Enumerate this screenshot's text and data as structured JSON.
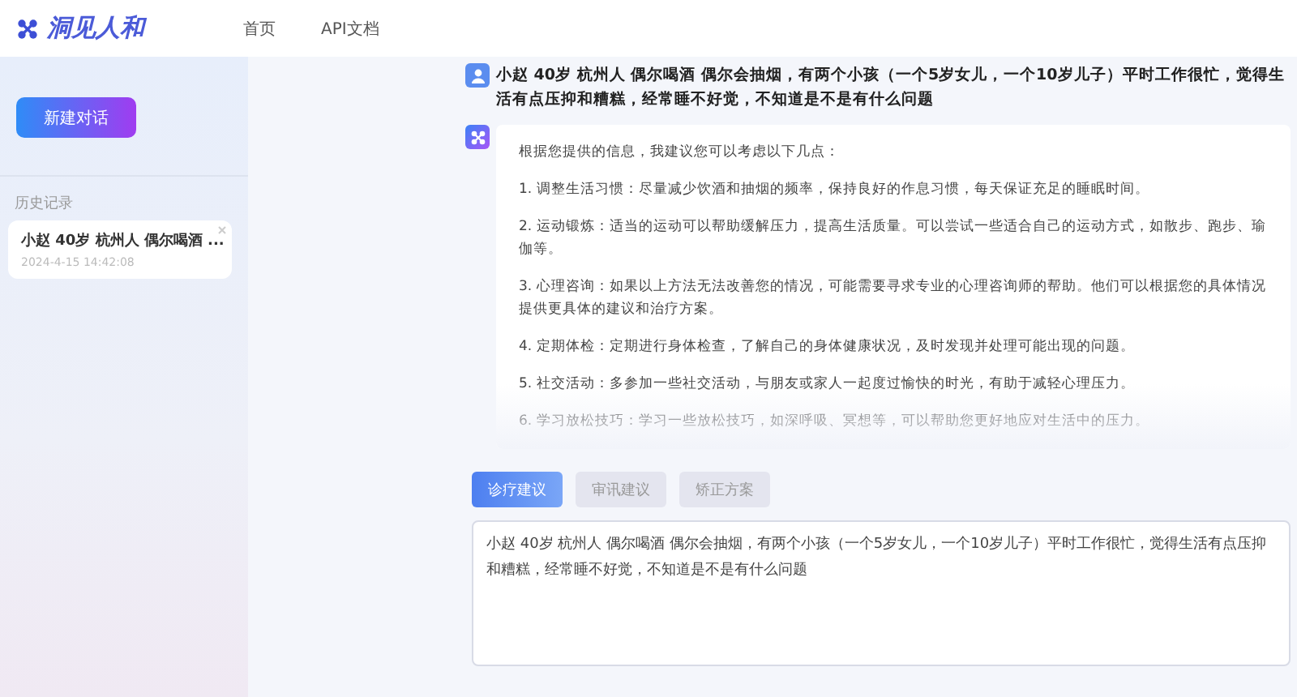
{
  "header": {
    "brand": "洞见人和",
    "nav": [
      {
        "label": "首页",
        "selected": false
      },
      {
        "label": "API文档",
        "selected": false
      }
    ]
  },
  "sidebar": {
    "new_chat_button": "新建对话",
    "history_title": "历史记录",
    "history": [
      {
        "title": "小赵 40岁 杭州人 偶尔喝酒 ...",
        "time": "2024-4-15 14:42:08"
      }
    ]
  },
  "chat": {
    "messages": [
      {
        "kind": "user",
        "paragraphs": [
          "小赵 40岁 杭州人 偶尔喝酒 偶尔会抽烟，有两个小孩（一个5岁女儿，一个10岁儿子）平时工作很忙，觉得生活有点压抑和糟糕，经常睡不好觉，不知道是不是有什么问题"
        ]
      },
      {
        "kind": "assistant",
        "paragraphs": [
          "根据您提供的信息，我建议您可以考虑以下几点：",
          "1. 调整生活习惯：尽量减少饮酒和抽烟的频率，保持良好的作息习惯，每天保证充足的睡眠时间。",
          "2. 运动锻炼：适当的运动可以帮助缓解压力，提高生活质量。可以尝试一些适合自己的运动方式，如散步、跑步、瑜伽等。",
          "3. 心理咨询：如果以上方法无法改善您的情况，可能需要寻求专业的心理咨询师的帮助。他们可以根据您的具体情况提供更具体的建议和治疗方案。",
          "4. 定期体检：定期进行身体检查，了解自己的身体健康状况，及时发现并处理可能出现的问题。",
          "5. 社交活动：多参加一些社交活动，与朋友或家人一起度过愉快的时光，有助于减轻心理压力。",
          "6. 学习放松技巧：学习一些放松技巧，如深呼吸、冥想等，可以帮助您更好地应对生活中的压力。"
        ]
      }
    ]
  },
  "composer": {
    "tabs": [
      {
        "label": "诊疗建议",
        "selected": true
      },
      {
        "label": "审讯建议",
        "selected": false
      },
      {
        "label": "矫正方案",
        "selected": false
      }
    ],
    "value": "小赵 40岁 杭州人 偶尔喝酒 偶尔会抽烟，有两个小孩（一个5岁女儿，一个10岁儿子）平时工作很忙，觉得生活有点压抑和糟糕，经常睡不好觉，不知道是不是有什么问题"
  }
}
